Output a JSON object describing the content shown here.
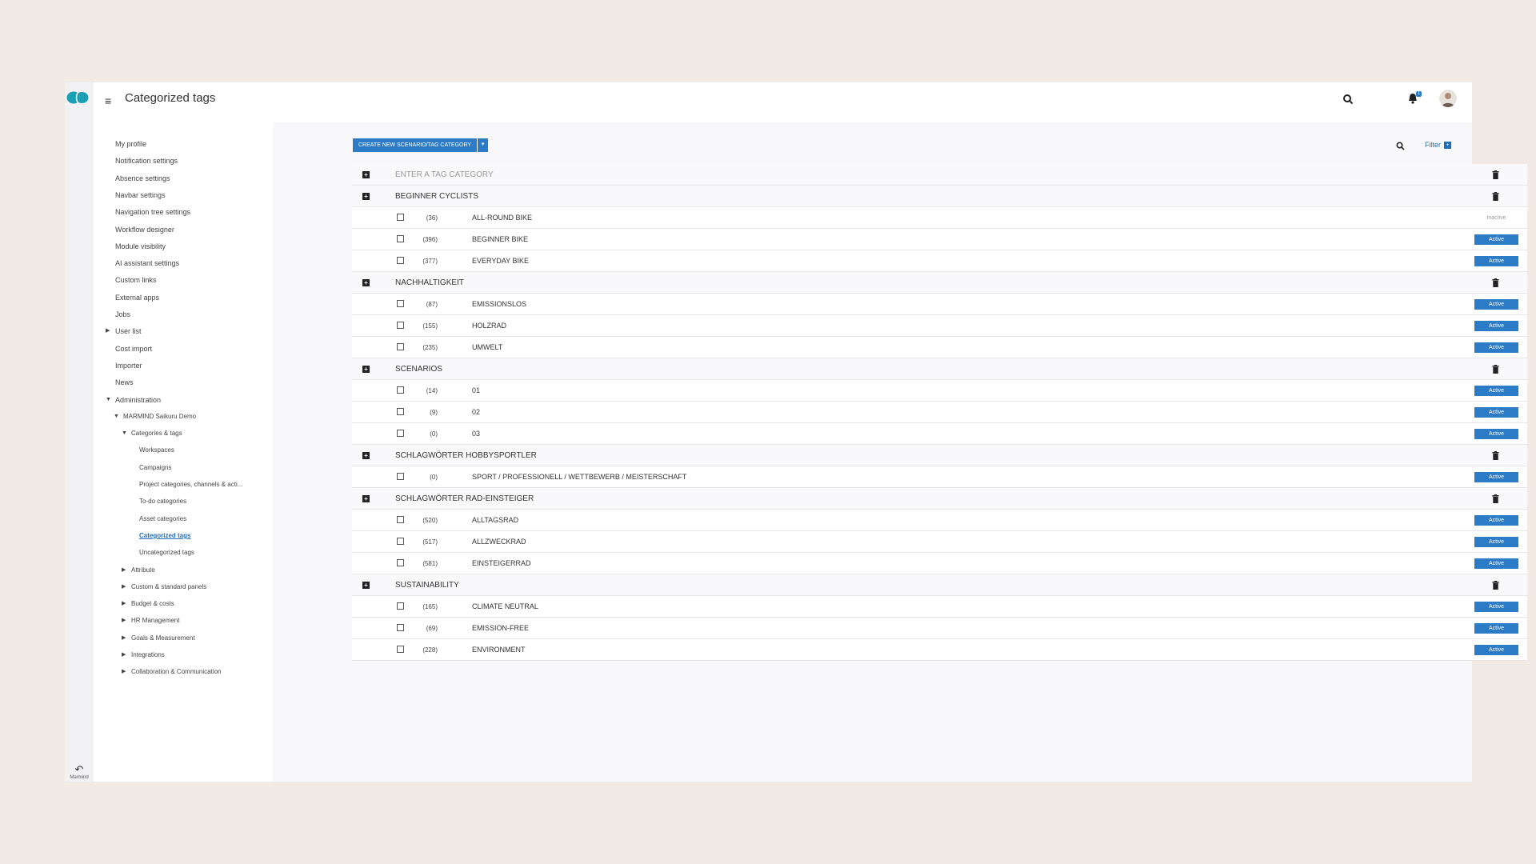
{
  "header": {
    "title": "Categorized tags",
    "notification_count": "1"
  },
  "rail": {
    "bottom_label": "Marmind"
  },
  "sidebar": {
    "items": [
      {
        "label": "My profile",
        "level": 0
      },
      {
        "label": "Notification settings",
        "level": 0
      },
      {
        "label": "Absence settings",
        "level": 0
      },
      {
        "label": "Navbar settings",
        "level": 0
      },
      {
        "label": "Navigation tree settings",
        "level": 0
      },
      {
        "label": "Workflow designer",
        "level": 0
      },
      {
        "label": "Module visibility",
        "level": 0
      },
      {
        "label": "AI assistant settings",
        "level": 0
      },
      {
        "label": "Custom links",
        "level": 0
      },
      {
        "label": "External apps",
        "level": 0
      },
      {
        "label": "Jobs",
        "level": 0
      },
      {
        "label": "User list",
        "level": 0,
        "caret": "right"
      },
      {
        "label": "Cost import",
        "level": 0
      },
      {
        "label": "Importer",
        "level": 0
      },
      {
        "label": "News",
        "level": 0
      },
      {
        "label": "Administration",
        "level": 0,
        "caret": "down"
      },
      {
        "label": "MARMIND Saikuru Demo",
        "level": 1,
        "caret": "down"
      },
      {
        "label": "Categories & tags",
        "level": 2,
        "caret": "down"
      },
      {
        "label": "Workspaces",
        "level": 3
      },
      {
        "label": "Campaigns",
        "level": 3
      },
      {
        "label": "Project categories, channels & acti...",
        "level": 3
      },
      {
        "label": "To-do categories",
        "level": 3
      },
      {
        "label": "Asset categories",
        "level": 3
      },
      {
        "label": "Categorized tags",
        "level": 3,
        "active": true
      },
      {
        "label": "Uncategorized tags",
        "level": 3
      },
      {
        "label": "Attribute",
        "level": 2,
        "caret": "right"
      },
      {
        "label": "Custom & standard panels",
        "level": 2,
        "caret": "right"
      },
      {
        "label": "Budget & costs",
        "level": 2,
        "caret": "right"
      },
      {
        "label": "HR Management",
        "level": 2,
        "caret": "right"
      },
      {
        "label": "Goals & Measurement",
        "level": 2,
        "caret": "right"
      },
      {
        "label": "Integrations",
        "level": 2,
        "caret": "right"
      },
      {
        "label": "Collaboration & Communication",
        "level": 2,
        "caret": "right"
      }
    ]
  },
  "toolbar": {
    "create_label": "CREATE NEW SCENARIO/TAG CATEGORY",
    "filter_label": "Filter"
  },
  "table": {
    "placeholder": "ENTER A TAG CATEGORY",
    "categories": [
      {
        "name": "BEGINNER CYCLISTS",
        "tags": [
          {
            "count": "(36)",
            "name": "ALL-ROUND BIKE",
            "status": "Inactive"
          },
          {
            "count": "(396)",
            "name": "BEGINNER BIKE",
            "status": "Active"
          },
          {
            "count": "(377)",
            "name": "EVERYDAY BIKE",
            "status": "Active"
          }
        ]
      },
      {
        "name": "NACHHALTIGKEIT",
        "tags": [
          {
            "count": "(87)",
            "name": "EMISSIONSLOS",
            "status": "Active"
          },
          {
            "count": "(155)",
            "name": "HOLZRAD",
            "status": "Active"
          },
          {
            "count": "(235)",
            "name": "UMWELT",
            "status": "Active"
          }
        ]
      },
      {
        "name": "SCENARIOS",
        "tags": [
          {
            "count": "(14)",
            "name": "01",
            "status": "Active"
          },
          {
            "count": "(9)",
            "name": "02",
            "status": "Active"
          },
          {
            "count": "(0)",
            "name": "03",
            "status": "Active"
          }
        ]
      },
      {
        "name": "SCHLAGWÖRTER HOBBYSPORTLER",
        "tags": [
          {
            "count": "(0)",
            "name": "SPORT / PROFESSIONELL / WETTBEWERB / MEISTERSCHAFT",
            "status": "Active"
          }
        ]
      },
      {
        "name": "SCHLAGWÖRTER RAD-EINSTEIGER",
        "tags": [
          {
            "count": "(520)",
            "name": "ALLTAGSRAD",
            "status": "Active"
          },
          {
            "count": "(517)",
            "name": "ALLZWECKRAD",
            "status": "Active"
          },
          {
            "count": "(581)",
            "name": "EINSTEIGERRAD",
            "status": "Active"
          }
        ]
      },
      {
        "name": "SUSTAINABILITY",
        "tags": [
          {
            "count": "(165)",
            "name": "CLIMATE NEUTRAL",
            "status": "Active"
          },
          {
            "count": "(69)",
            "name": "EMISSION-FREE",
            "status": "Active"
          },
          {
            "count": "(228)",
            "name": "ENVIRONMENT",
            "status": "Active"
          }
        ]
      }
    ]
  },
  "colors": {
    "accent": "#2b7bc7",
    "logo": "#1aa0b4",
    "background": "#f2ebe5"
  }
}
